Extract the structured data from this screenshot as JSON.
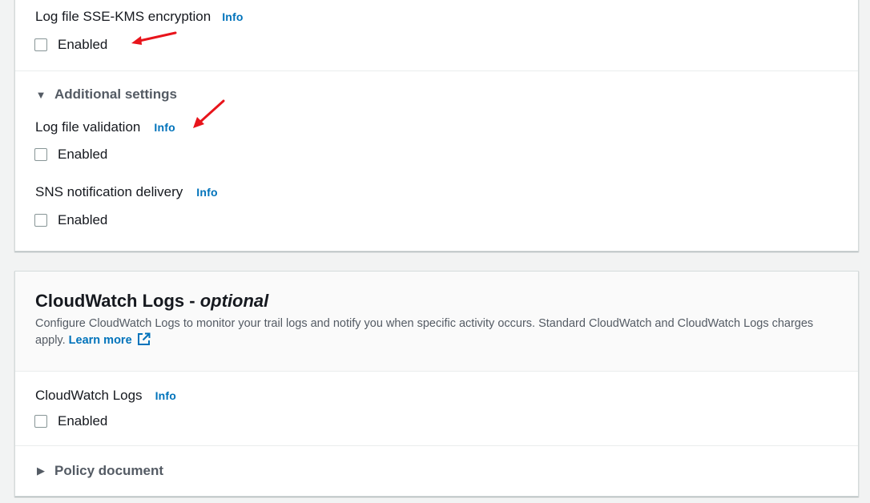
{
  "kms_section": {
    "label": "Log file SSE-KMS encryption",
    "info": "Info",
    "checkbox_label": "Enabled"
  },
  "additional_settings": {
    "label": "Additional settings",
    "log_validation": {
      "label": "Log file validation",
      "info": "Info",
      "checkbox_label": "Enabled"
    },
    "sns_delivery": {
      "label": "SNS notification delivery",
      "info": "Info",
      "checkbox_label": "Enabled"
    }
  },
  "cloudwatch": {
    "title": "CloudWatch Logs",
    "title_sep": " - ",
    "title_optional": "optional",
    "description": "Configure CloudWatch Logs to monitor your trail logs and notify you when specific activity occurs. Standard CloudWatch and CloudWatch Logs charges apply.",
    "learn_more": "Learn more",
    "field": {
      "label": "CloudWatch Logs",
      "info": "Info",
      "checkbox_label": "Enabled"
    },
    "policy_document": "Policy document"
  },
  "icons": {
    "expanded_caret": "caret-down-icon",
    "collapsed_caret": "caret-right-icon",
    "external_link": "external-link-icon"
  },
  "colors": {
    "link": "#0073bb",
    "annotation_arrow": "#e8141b",
    "page_background": "#f2f3f3"
  }
}
